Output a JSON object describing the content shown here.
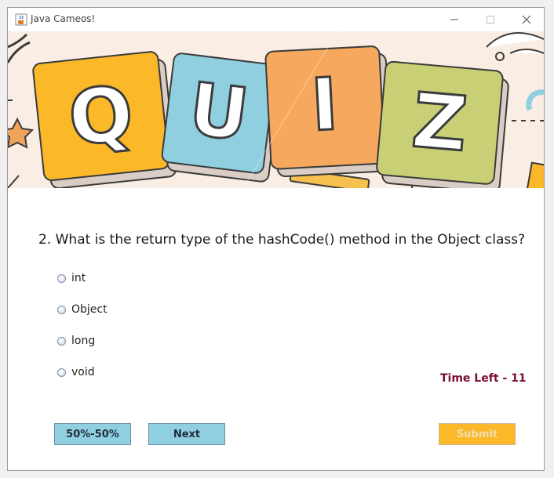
{
  "window": {
    "title": "Java Cameos!"
  },
  "banner": {
    "letters": [
      "Q",
      "U",
      "I",
      "Z"
    ]
  },
  "question": {
    "text": "2. What is the return type of the hashCode() method in the Object class?"
  },
  "options": [
    "int",
    "Object",
    "long",
    "void"
  ],
  "timer": {
    "label": "Time Left - 11"
  },
  "buttons": {
    "fifty": "50%-50%",
    "next": "Next",
    "submit": "Submit"
  },
  "colors": {
    "button_blue": "#8fcfe0",
    "submit_orange": "#fbb829",
    "timer": "#7a0f2e"
  }
}
